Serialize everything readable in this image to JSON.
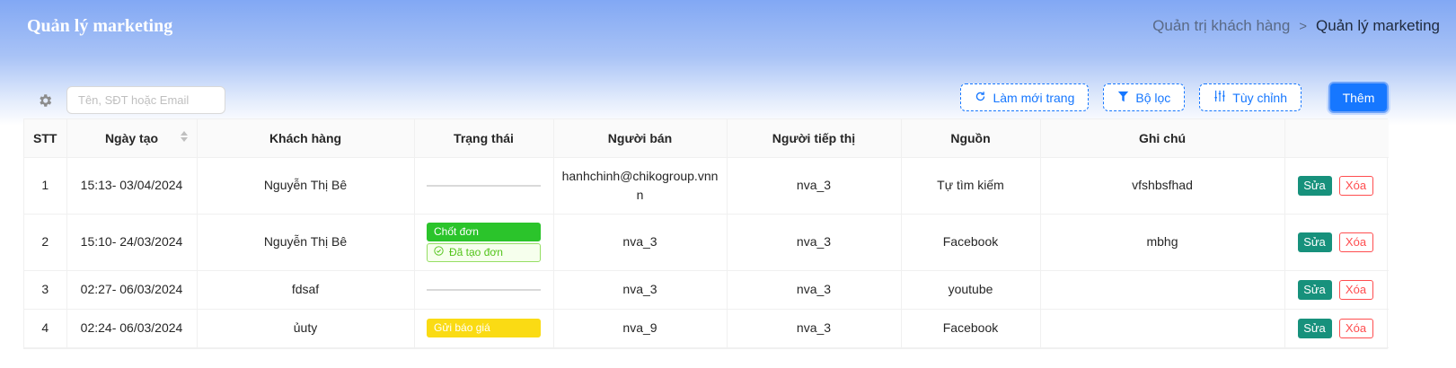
{
  "header": {
    "title": "Quản lý marketing",
    "breadcrumb": {
      "parent": "Quản trị khách hàng",
      "separator": ">",
      "current": "Quản lý marketing"
    }
  },
  "toolbar": {
    "search_placeholder": "Tên, SĐT hoặc Email",
    "refresh_label": "Làm mới trang",
    "filter_label": "Bộ lọc",
    "customize_label": "Tùy chỉnh",
    "add_label": "Thêm"
  },
  "colors": {
    "primary": "#1677ff",
    "edit_button": "#17917c",
    "delete_button": "#ff4d4f",
    "tag_green": "#2bc42b",
    "tag_yellow": "#fadb14"
  },
  "table": {
    "columns": [
      "STT",
      "Ngày tạo",
      "Khách hàng",
      "Trạng thái",
      "Người bán",
      "Người tiếp thị",
      "Nguồn",
      "Ghi chú",
      ""
    ],
    "edit_label": "Sửa",
    "delete_label": "Xóa",
    "rows": [
      {
        "stt": "1",
        "created": "15:13- 03/04/2024",
        "customer": "Nguyễn Thị Bê",
        "status": [],
        "seller": "hanhchinh@chikogroup.vnnn",
        "marketer": "nva_3",
        "source": "Tự tìm kiếm",
        "note": "vfshbsfhad"
      },
      {
        "stt": "2",
        "created": "15:10- 24/03/2024",
        "customer": "Nguyễn Thị Bê",
        "status": [
          "Chốt đơn",
          "Đã tạo đơn"
        ],
        "seller": "nva_3",
        "marketer": "nva_3",
        "source": "Facebook",
        "note": "mbhg"
      },
      {
        "stt": "3",
        "created": "02:27- 06/03/2024",
        "customer": "fdsaf",
        "status": [],
        "seller": "nva_3",
        "marketer": "nva_3",
        "source": "youtube",
        "note": ""
      },
      {
        "stt": "4",
        "created": "02:24- 06/03/2024",
        "customer": "ủuty",
        "status": [
          "Gửi báo giá"
        ],
        "seller": "nva_9",
        "marketer": "nva_3",
        "source": "Facebook",
        "note": ""
      }
    ]
  }
}
